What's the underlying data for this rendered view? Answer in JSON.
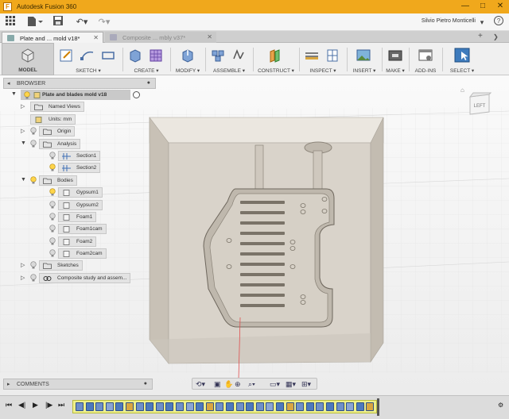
{
  "window": {
    "app_title": "Autodesk Fusion 360",
    "user_name": "Silvio Pietro Monticelli",
    "minimize": "—",
    "maximize": "□",
    "close": "✕"
  },
  "tabs": [
    {
      "label": "Plate and ... mold v18*",
      "active": true
    },
    {
      "label": "Composite ... mbly v37*",
      "active": false
    }
  ],
  "ribbon": {
    "workspace": "MODEL",
    "groups": [
      "SKETCH",
      "CREATE",
      "MODIFY",
      "ASSEMBLE",
      "CONSTRUCT",
      "INSPECT",
      "INSERT",
      "MAKE",
      "ADD-INS",
      "SELECT"
    ]
  },
  "browser": {
    "header": "BROWSER",
    "root": "Plate and blades mold v18",
    "items": [
      {
        "label": "Named Views",
        "level": 1,
        "arrow": true,
        "bulb": false,
        "icon": "folder"
      },
      {
        "label": "Units: mm",
        "level": 1,
        "arrow": false,
        "bulb": false,
        "icon": "doc"
      },
      {
        "label": "Origin",
        "level": 1,
        "arrow": true,
        "bulb": "off",
        "icon": "folder"
      },
      {
        "label": "Analysis",
        "level": 1,
        "arrow": "down",
        "bulb": "off",
        "icon": "folder"
      },
      {
        "label": "Section1",
        "level": 2,
        "arrow": false,
        "bulb": "off",
        "icon": "section"
      },
      {
        "label": "Section2",
        "level": 2,
        "arrow": false,
        "bulb": "on",
        "icon": "section"
      },
      {
        "label": "Bodies",
        "level": 1,
        "arrow": "down",
        "bulb": "on",
        "icon": "folder"
      },
      {
        "label": "Gypsum1",
        "level": 2,
        "arrow": false,
        "bulb": "on",
        "icon": "body"
      },
      {
        "label": "Gypsum2",
        "level": 2,
        "arrow": false,
        "bulb": "off",
        "icon": "body"
      },
      {
        "label": "Foam1",
        "level": 2,
        "arrow": false,
        "bulb": "off",
        "icon": "body"
      },
      {
        "label": "Foam1cam",
        "level": 2,
        "arrow": false,
        "bulb": "off",
        "icon": "body"
      },
      {
        "label": "Foam2",
        "level": 2,
        "arrow": false,
        "bulb": "off",
        "icon": "body"
      },
      {
        "label": "Foam2cam",
        "level": 2,
        "arrow": false,
        "bulb": "off",
        "icon": "body"
      },
      {
        "label": "Sketches",
        "level": 1,
        "arrow": true,
        "bulb": "off",
        "icon": "folder"
      },
      {
        "label": "Composite study and assem...",
        "level": 1,
        "arrow": true,
        "bulb": "off",
        "icon": "link"
      }
    ]
  },
  "viewcube": {
    "face": "LEFT"
  },
  "comments": {
    "header": "COMMENTS"
  },
  "colors": {
    "titlebar": "#f0a81c",
    "mold": "#d8d2c8",
    "cavity": "#bdb5aa",
    "selection": "#4c8bd6"
  }
}
